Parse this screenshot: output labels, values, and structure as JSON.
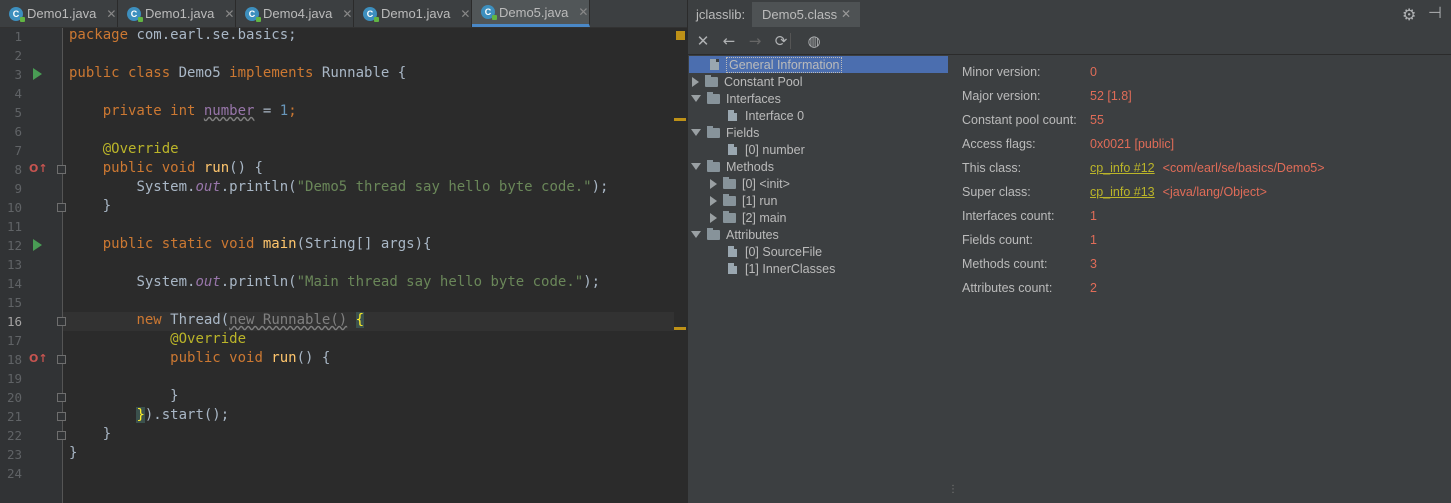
{
  "editor_tabs": [
    {
      "label": "Demo1.java",
      "icon": "c-class-icon"
    },
    {
      "label": "Demo1.java",
      "icon": "c-class-icon"
    },
    {
      "label": "Demo4.java",
      "icon": "c-class-icon"
    },
    {
      "label": "Demo1.java",
      "icon": "c-class-icon"
    },
    {
      "label": "Demo5.java",
      "icon": "c-class-icon",
      "active": true
    }
  ],
  "line_numbers": [
    "1",
    "2",
    "3",
    "4",
    "5",
    "6",
    "7",
    "8",
    "9",
    "10",
    "11",
    "12",
    "13",
    "14",
    "15",
    "16",
    "17",
    "18",
    "19",
    "20",
    "21",
    "22",
    "23",
    "24"
  ],
  "code": {
    "l1_kw": "package",
    "l1_rest": " com.earl.se.basics;",
    "l3_kw1": "public class",
    "l3_name": " Demo5 ",
    "l3_kw2": "implements",
    "l3_rest": " Runnable {",
    "l5_kw": "private int",
    "l5_sp": " ",
    "l5_field": "number",
    "l5_eq": " = ",
    "l5_num": "1",
    "l5_end": ";",
    "l7_ann": "@Override",
    "l8_kw": "public void",
    "l8_fn": " run",
    "l8_rest": "() {",
    "l9_a": "System.",
    "l9_out": "out",
    "l9_b": ".println(",
    "l9_str": "\"Demo5 thread say hello byte code.\"",
    "l9_c": ");",
    "l10": "}",
    "l12_kw": "public static void",
    "l12_fn": " main",
    "l12_rest": "(String[] args){",
    "l14_a": "System.",
    "l14_out": "out",
    "l14_b": ".println(",
    "l14_str": "\"Main thread say hello byte code.\"",
    "l14_c": ");",
    "l16_kw": "new",
    "l16_a": " Thread(",
    "l16_new": "new Runnable()",
    "l16_sp": " ",
    "l16_brace": "{",
    "l17_ann": "@Override",
    "l18_kw": "public void",
    "l18_fn": " run",
    "l18_rest": "() {",
    "l20": "}",
    "l21_brace": "}",
    "l21_rest": ").start();",
    "l22": "}",
    "l23": "}"
  },
  "jclasslib": {
    "tool_title": "jclasslib:",
    "tab": "Demo5.class",
    "tree": [
      {
        "label": "General Information",
        "level": 0,
        "type": "file",
        "selected": true
      },
      {
        "label": "Constant Pool",
        "level": 0,
        "type": "folder",
        "expanded": false
      },
      {
        "label": "Interfaces",
        "level": 0,
        "type": "folder",
        "expanded": true
      },
      {
        "label": "Interface 0",
        "level": 1,
        "type": "file"
      },
      {
        "label": "Fields",
        "level": 0,
        "type": "folder",
        "expanded": true
      },
      {
        "label": "[0] number",
        "level": 1,
        "type": "file"
      },
      {
        "label": "Methods",
        "level": 0,
        "type": "folder",
        "expanded": true
      },
      {
        "label": "[0] <init>",
        "level": 1,
        "type": "folder",
        "expanded": false
      },
      {
        "label": "[1] run",
        "level": 1,
        "type": "folder",
        "expanded": false
      },
      {
        "label": "[2] main",
        "level": 1,
        "type": "folder",
        "expanded": false
      },
      {
        "label": "Attributes",
        "level": 0,
        "type": "folder",
        "expanded": true
      },
      {
        "label": "[0] SourceFile",
        "level": 1,
        "type": "file"
      },
      {
        "label": "[1] InnerClasses",
        "level": 1,
        "type": "file"
      }
    ],
    "properties": [
      {
        "label": "Minor version:",
        "value": "0"
      },
      {
        "label": "Major version:",
        "value": "52 [1.8]"
      },
      {
        "label": "Constant pool count:",
        "value": "55"
      },
      {
        "label": "Access flags:",
        "value": "0x0021 [public]"
      },
      {
        "label": "This class:",
        "link": "cp_info #12",
        "value": "<com/earl/se/basics/Demo5>"
      },
      {
        "label": "Super class:",
        "link": "cp_info #13",
        "value": "<java/lang/Object>"
      },
      {
        "label": "Interfaces count:",
        "value": "1"
      },
      {
        "label": "Fields count:",
        "value": "1"
      },
      {
        "label": "Methods count:",
        "value": "3"
      },
      {
        "label": "Attributes count:",
        "value": "2"
      }
    ]
  },
  "colors": {
    "keyword": "#cc7832",
    "string": "#6a8759",
    "annotation": "#bbb529",
    "function": "#ffc66d",
    "value": "#e06c58"
  }
}
